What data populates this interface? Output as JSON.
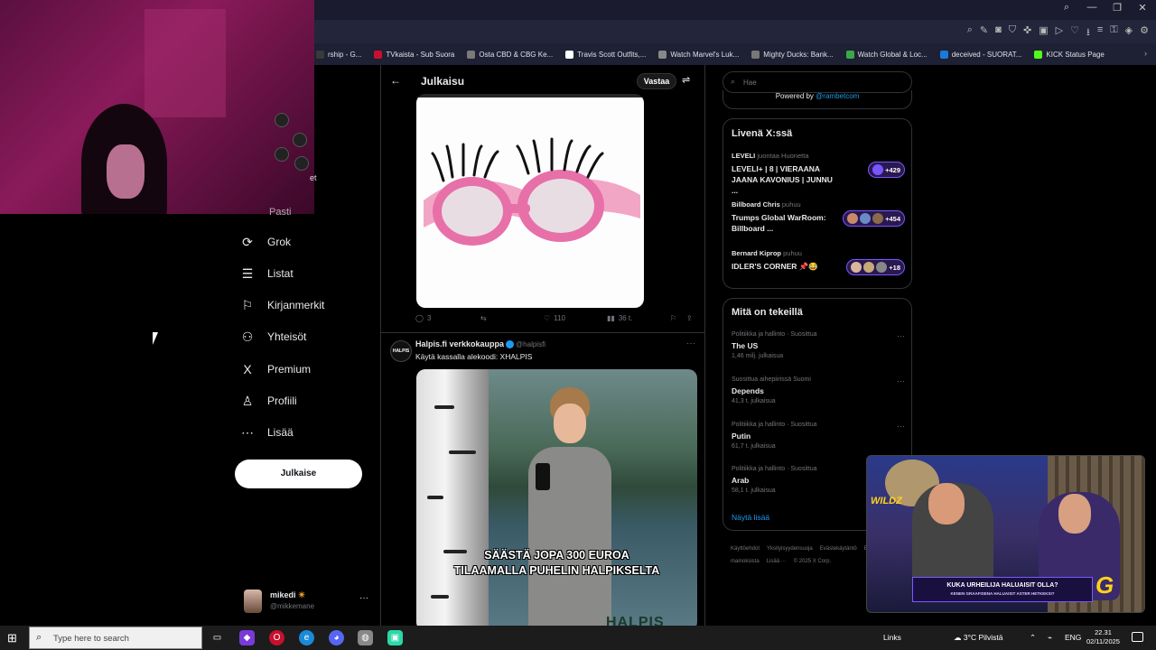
{
  "browser": {
    "bookmarks": [
      {
        "label": "rship - G...",
        "color": "#3a3a3a"
      },
      {
        "label": "TVkaista - Sub Suora",
        "color": "#c8102e"
      },
      {
        "label": "Osta CBD & CBG Ke...",
        "color": "#7a7a7a"
      },
      {
        "label": "Travis Scott Outfits,...",
        "color": "#ffffff"
      },
      {
        "label": "Watch Marvel's Luk...",
        "color": "#888888"
      },
      {
        "label": "Mighty Ducks: Bank...",
        "color": "#777777"
      },
      {
        "label": "Watch Global & Loc...",
        "color": "#3aa84a"
      },
      {
        "label": "deceived - SUORAT...",
        "color": "#1a7ad8"
      },
      {
        "label": "KICK Status Page",
        "color": "#53fc18"
      }
    ]
  },
  "webcam": {
    "partial_label": "et"
  },
  "nav": {
    "partial_item": "Pasti",
    "items": [
      {
        "label": "Grok",
        "icon": "grok-icon",
        "glyph": "⟳"
      },
      {
        "label": "Listat",
        "icon": "list-icon",
        "glyph": "☰"
      },
      {
        "label": "Kirjanmerkit",
        "icon": "bookmark-icon",
        "glyph": "⚐"
      },
      {
        "label": "Yhteisöt",
        "icon": "communities-icon",
        "glyph": "⚇"
      },
      {
        "label": "Premium",
        "icon": "x-logo-icon",
        "glyph": "X"
      },
      {
        "label": "Profiili",
        "icon": "profile-icon",
        "glyph": "♙"
      },
      {
        "label": "Lisää",
        "icon": "more-circle-icon",
        "glyph": "⋯"
      }
    ],
    "post_button": "Julkaise",
    "account": {
      "name": "mikedi",
      "handle": "@mikkemane"
    }
  },
  "main": {
    "title": "Julkaisu",
    "reply_button": "Vastaa",
    "actions": {
      "replies": "3",
      "likes": "110",
      "views": "36 t."
    },
    "post2": {
      "name": "Halpis.fi verkkokauppa",
      "handle": "@halpisfi",
      "avatar_text": "HALPIS",
      "text": "Käytä kassalla alekoodi: XHALPIS",
      "caption_line1": "SÄÄSTÄ JOPA 300 EUROA",
      "caption_line2": "TILAAMALLA PUHELIN HALPIKSELTA",
      "watermark": "HALPIS"
    }
  },
  "right": {
    "search_placeholder": "Hae",
    "powered_by": "Powered by",
    "powered_by_link": "@rambetcom",
    "live": {
      "title": "Livenä X:ssä",
      "items": [
        {
          "host": "LEVELI",
          "status": "juontaa Huonetta",
          "title": "LEVELI+ | 8 | VIERAANA JAANA KAVONIUS | JUNNU ...",
          "count": "+429"
        },
        {
          "host": "Billboard Chris",
          "status": "puhuu",
          "title": "Trumps Global WarRoom: Billboard ...",
          "count": "+454"
        },
        {
          "host": "Bernard Kiprop",
          "status": "puhuu",
          "title": "IDLER'S CORNER 📌😂",
          "count": "+18"
        }
      ]
    },
    "trends": {
      "title": "Mitä on tekeillä",
      "items": [
        {
          "context": "Politiikka ja hallinto · Suosittua",
          "name": "The US",
          "count": "1,46 milj. julkaisua"
        },
        {
          "context": "Suosittua aihepiirissä Suomi",
          "name": "Depends",
          "count": "41,3 t. julkaisua"
        },
        {
          "context": "Politiikka ja hallinto · Suosittua",
          "name": "Putin",
          "count": "61,7 t. julkaisua"
        },
        {
          "context": "Politiikka ja hallinto · Suosittua",
          "name": "Arab",
          "count": "58,1 t. julkaisua"
        }
      ],
      "show_more": "Näytä lisää"
    },
    "footer": [
      "Käyttöehdot",
      "Yksityisyydensuoja",
      "Evästekäytäntö",
      "Esteettömyys",
      "Tietoa mainoksista",
      "Lisää ···",
      "© 2025 X Corp."
    ]
  },
  "stream": {
    "banner": "KUKA URHEILIJA HALUAISIT OLLA?",
    "banner_sub": "KENEN GRAAFISENA HALUAISIT ASTER HETKEKSI?",
    "brand": "WILDZ",
    "logo": "G"
  },
  "taskbar": {
    "search_placeholder": "Type here to search",
    "links": "Links",
    "weather": "3°C Pilvistä",
    "lang": "ENG",
    "time": "22.31",
    "date": "02/11/2025"
  }
}
